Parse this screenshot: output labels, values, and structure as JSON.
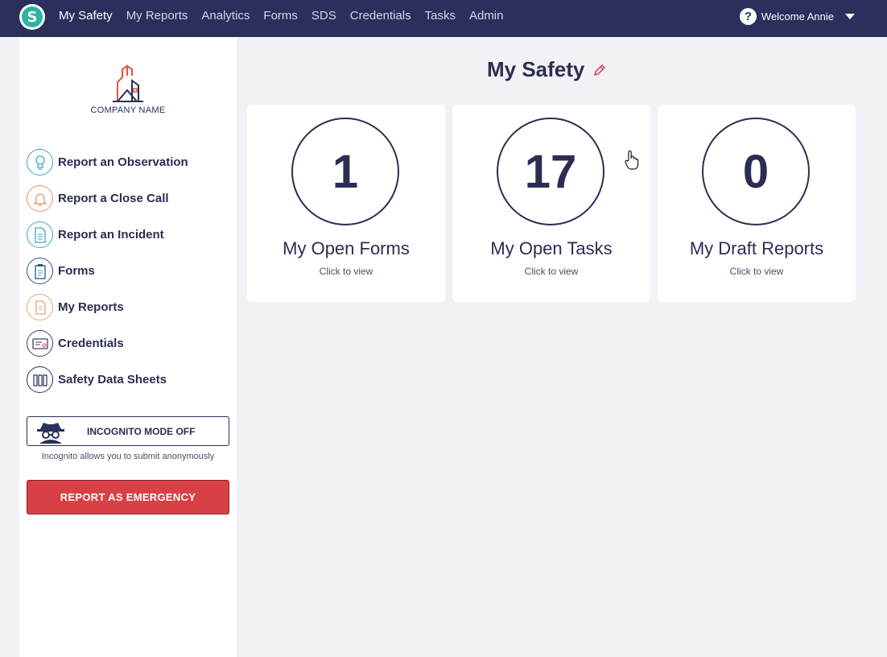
{
  "nav": {
    "logo_letter": "S",
    "items": [
      {
        "label": "My Safety",
        "active": true
      },
      {
        "label": "My Reports",
        "active": false
      },
      {
        "label": "Analytics",
        "active": false
      },
      {
        "label": "Forms",
        "active": false
      },
      {
        "label": "SDS",
        "active": false
      },
      {
        "label": "Credentials",
        "active": false
      },
      {
        "label": "Tasks",
        "active": false
      },
      {
        "label": "Admin",
        "active": false
      }
    ],
    "help_glyph": "?",
    "user_label": "Welcome Annie"
  },
  "sidebar": {
    "company_name": "COMPANY NAME",
    "items": [
      {
        "label": "Report an Observation",
        "icon": "lightbulb-icon",
        "color": "#3fa6c4"
      },
      {
        "label": "Report a Close Call",
        "icon": "bell-icon",
        "color": "#e8955a"
      },
      {
        "label": "Report an Incident",
        "icon": "document-icon",
        "color": "#3fa6c4"
      },
      {
        "label": "Forms",
        "icon": "clipboard-icon",
        "color": "#2a5a7a"
      },
      {
        "label": "My Reports",
        "icon": "reports-icon",
        "color": "#e8a07a"
      },
      {
        "label": "Credentials",
        "icon": "id-card-icon",
        "color": "#4a3c6a"
      },
      {
        "label": "Safety Data Sheets",
        "icon": "binders-icon",
        "color": "#2a2f5b"
      }
    ],
    "incognito_label": "INCOGNITO MODE OFF",
    "incognito_note": "Incognito allows you to submit anonymously",
    "emergency_label": "REPORT AS EMERGENCY"
  },
  "main": {
    "title": "My Safety",
    "cards": [
      {
        "count": "1",
        "title": "My Open Forms",
        "subtitle": "Click to view"
      },
      {
        "count": "17",
        "title": "My Open Tasks",
        "subtitle": "Click to view"
      },
      {
        "count": "0",
        "title": "My Draft Reports",
        "subtitle": "Click to view"
      }
    ]
  },
  "colors": {
    "nav_bg": "#2a2f5b",
    "accent_teal": "#2bb3a3",
    "emergency_red": "#d94046",
    "text_dark": "#2b2d52",
    "page_bg": "#f2f2f6"
  }
}
